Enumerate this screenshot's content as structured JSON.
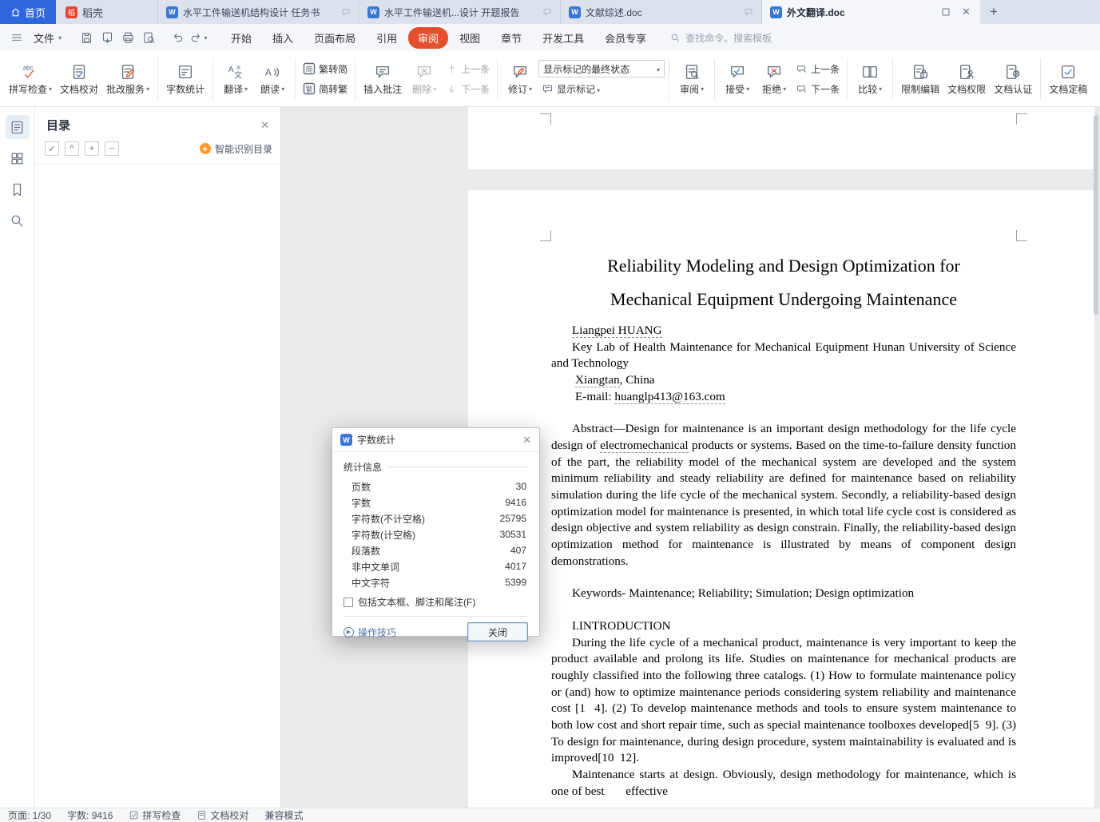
{
  "icons": {
    "close": "✕",
    "plus": "+"
  },
  "tabbar": {
    "home": "首页",
    "docer": "稻壳",
    "tabs": [
      "水平工件输送机结构设计 任务书",
      "水平工件输送机...设计 开题报告",
      "文献综述.doc",
      "外文翻译.doc"
    ]
  },
  "menubar": {
    "file": "文件",
    "tabs": [
      "开始",
      "插入",
      "页面布局",
      "引用",
      "审阅",
      "视图",
      "章节",
      "开发工具",
      "会员专享"
    ],
    "search": "查找命令、搜索模板"
  },
  "ribbon": {
    "spell": "拼写检查",
    "proof": "文档校对",
    "grading": "批改服务",
    "wordcount": "字数统计",
    "translate": "翻译",
    "readaloud": "朗读",
    "t2s": "繁转简",
    "s2t": "简转繁",
    "insert_comment": "插入批注",
    "del": "删除",
    "prev1": "上一条",
    "next1": "下一条",
    "markup_state": "显示标记的最终状态",
    "revise": "修订",
    "show_markup": "显示标记",
    "review": "审阅",
    "accept": "接受",
    "reject": "拒绝",
    "prev2": "上一条",
    "next2": "下一条",
    "compare": "比较",
    "restrict": "限制编辑",
    "perm": "文档权限",
    "certify": "文档认证",
    "finalize": "文档定稿"
  },
  "sidebar": {
    "title": "目录",
    "smart_toc": "智能识别目录"
  },
  "document": {
    "title1": "Reliability Modeling and Design Optimization for",
    "title2": "Mechanical Equipment Undergoing Maintenance",
    "author": "Liangpei HUANG",
    "affiliation": "Key Lab of Health Maintenance for Mechanical Equipment Hunan University of Science and Technology",
    "city_name": "Xiangtan",
    "city_rest": ", China",
    "email_label": "E-mail: ",
    "email": "huanglp413@163.com",
    "abstract_a": "Abstract—Design for maintenance is an important design methodology for the life cycle design of ",
    "abstract_word": "electromechanical",
    "abstract_b": " products or systems. Based on the time-to-failure density function of the part, the reliability model of the mechanical system are developed and the system minimum reliability and steady reliability are defined for maintenance based on reliability simulation during the life cycle of the mechanical system. Secondly, a reliability-based design optimization model for maintenance is presented, in which total life cycle cost is considered as design objective and system reliability as design constrain. Finally, the reliability-based design optimization method for maintenance is illustrated by means of component design demonstrations.",
    "keywords": "Keywords- Maintenance; Reliability; Simulation; Design optimization",
    "section1": "I.INTRODUCTION",
    "para1": "During the life cycle of a mechanical product, maintenance is very important to keep the product available and prolong its life. Studies on maintenance for mechanical products are roughly classified into the following three catalogs. (1) How to formulate maintenance policy or (and) how to optimize maintenance periods considering system reliability and maintenance cost [1  4]. (2) To develop maintenance methods and tools to ensure system maintenance to both low cost and short repair time, such as special maintenance toolboxes developed[5  9]. (3) To design for maintenance, during design procedure, system maintainability is evaluated and is improved[10  12].",
    "para2": "Maintenance starts at design. Obviously, design methodology for maintenance, which is one of best       effective"
  },
  "wordcount": {
    "title": "字数统计",
    "section": "统计信息",
    "rows": [
      {
        "label": "页数",
        "value": "30"
      },
      {
        "label": "字数",
        "value": "9416"
      },
      {
        "label": "字符数(不计空格)",
        "value": "25795"
      },
      {
        "label": "字符数(计空格)",
        "value": "30531"
      },
      {
        "label": "段落数",
        "value": "407"
      },
      {
        "label": "非中文单词",
        "value": "4017"
      },
      {
        "label": "中文字符",
        "value": "5399"
      }
    ],
    "checkbox": "包括文本框、脚注和尾注(F)",
    "tips": "操作技巧",
    "close": "关闭"
  },
  "statusbar": {
    "page": "页面: 1/30",
    "words": "字数: 9416",
    "spell": "拼写检查",
    "proof": "文档校对",
    "compat": "兼容模式"
  }
}
